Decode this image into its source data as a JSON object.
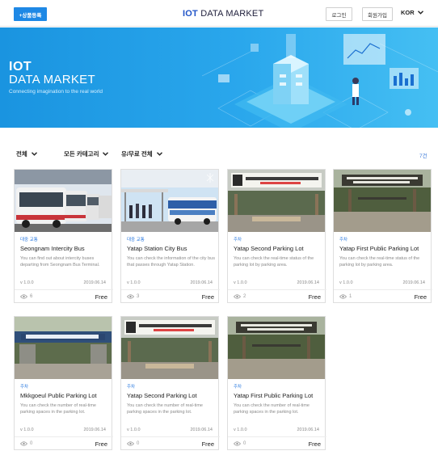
{
  "header": {
    "register_label": "+상품등록",
    "logo_bold": "IOT",
    "logo_rest": " DATA MARKET",
    "login_label": "로그인",
    "signup_label": "회원가입",
    "language": "KOR"
  },
  "banner": {
    "title_line1": "IOT",
    "title_line2": "DATA MARKET",
    "subtitle": "Connecting imagination to the real world"
  },
  "filters": {
    "all_label": "전체",
    "category_label": "모든 카테고리",
    "price_label": "유/무료 전체",
    "count": "7건"
  },
  "colors": {
    "accent": "#1e88e5",
    "banner": "#2aa7ec",
    "category": "#2e7ce0"
  },
  "icons": {
    "dropdown": "chevron-down-icon",
    "views": "eye-icon"
  },
  "cards": [
    {
      "category": "대중 교통",
      "title": "Seongnam Intercity Bus",
      "description": "You can find out about intercity buses departing from Seongnam Bus Terminal.",
      "version": "v 1.0.0",
      "date": "2019.06.14",
      "views": "6",
      "price": "Free"
    },
    {
      "category": "대중 교통",
      "title": "Yatap Station City Bus",
      "description": "You can check the information of the city bus that passes through Yatap Station.",
      "version": "v 1.0.0",
      "date": "2019.06.14",
      "views": "3",
      "price": "Free"
    },
    {
      "category": "주차",
      "title": "Yatap Second Parking Lot",
      "description": "You can check the real-time status of the parking lot by parking area.",
      "version": "v 1.0.0",
      "date": "2019.06.14",
      "views": "2",
      "price": "Free"
    },
    {
      "category": "주차",
      "title": "Yatap First Public Parking Lot",
      "description": "You can check the real-time status of the parking lot by parking area.",
      "version": "v 1.0.0",
      "date": "2019.06.14",
      "views": "1",
      "price": "Free"
    },
    {
      "category": "주차",
      "title": "Mkkgoeul Public Parking Lot",
      "description": "You can check the number of real-time parking spaces in the parking lot.",
      "version": "v 1.0.0",
      "date": "2019.06.14",
      "views": "0",
      "price": "Free"
    },
    {
      "category": "주차",
      "title": "Yatap Second Parking Lot",
      "description": "You can check the number of real-time parking spaces in the parking lot.",
      "version": "v 1.0.0",
      "date": "2019.06.14",
      "views": "0",
      "price": "Free"
    },
    {
      "category": "주차",
      "title": "Yatap First Public Parking Lot",
      "description": "You can check the number of real-time parking spaces in the parking lot.",
      "version": "v 1.0.0",
      "date": "2019.06.14",
      "views": "0",
      "price": "Free"
    }
  ]
}
